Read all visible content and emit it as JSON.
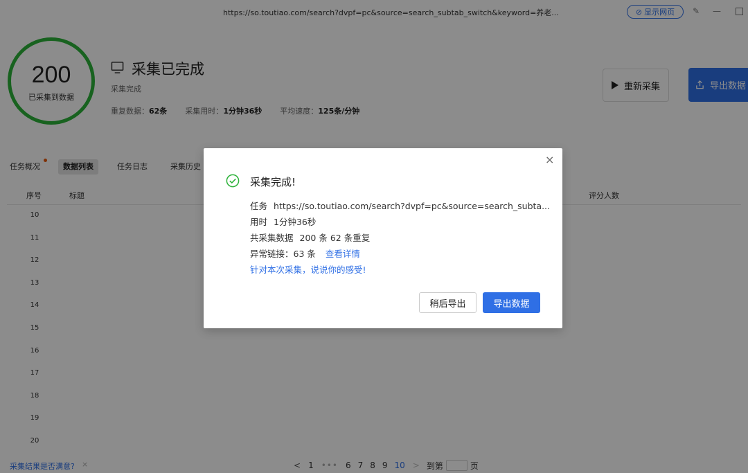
{
  "titlebar": {
    "url": "https://so.toutiao.com/search?dvpf=pc&source=search_subtab_switch&keyword=养老...",
    "show_web_label": "显示网页"
  },
  "summary": {
    "count": "200",
    "count_label": "已采集到数据",
    "title": "采集已完成",
    "subtitle": "采集完成",
    "stats": [
      {
        "label": "重复数据：",
        "value": "62条"
      },
      {
        "label": "采集用时：",
        "value": "1分钟36秒"
      },
      {
        "label": "平均速度：",
        "value": "125条/分钟"
      }
    ],
    "recollect_label": "重新采集",
    "export_label": "导出数据"
  },
  "tabs": [
    {
      "label": "任务概况"
    },
    {
      "label": "数据列表"
    },
    {
      "label": "任务日志"
    },
    {
      "label": "采集历史"
    }
  ],
  "table": {
    "columns": [
      "序号",
      "标题",
      "评分人数"
    ],
    "row_numbers": [
      "10",
      "11",
      "12",
      "13",
      "14",
      "15",
      "16",
      "17",
      "18",
      "19",
      "20"
    ]
  },
  "footer": {
    "feedback": "采集结果是否满意?",
    "close": "×"
  },
  "pagination": {
    "prev": "<",
    "first": "1",
    "ellipsis": "•••",
    "pages": [
      "6",
      "7",
      "8",
      "9",
      "10"
    ],
    "current": "10",
    "next": ">",
    "goto_prefix": "到第",
    "goto_suffix": "页"
  },
  "modal": {
    "title": "采集完成!",
    "task_label": "任务",
    "task_value": "https://so.toutiao.com/search?dvpf=pc&source=search_subta...",
    "time_label": "用时",
    "time_value": "1分钟36秒",
    "total_label": "共采集数据",
    "total_value": "200 条 62 条重复",
    "error_label": "异常链接：",
    "error_value": "63 条",
    "details_link": "查看详情",
    "feedback_link": "针对本次采集，说说你的感受!",
    "later_button": "稍后导出",
    "export_button": "导出数据",
    "close": "×"
  },
  "colors": {
    "accent": "#2f6fe5",
    "success": "#2db23a",
    "tab_dot": "#e8590c"
  }
}
